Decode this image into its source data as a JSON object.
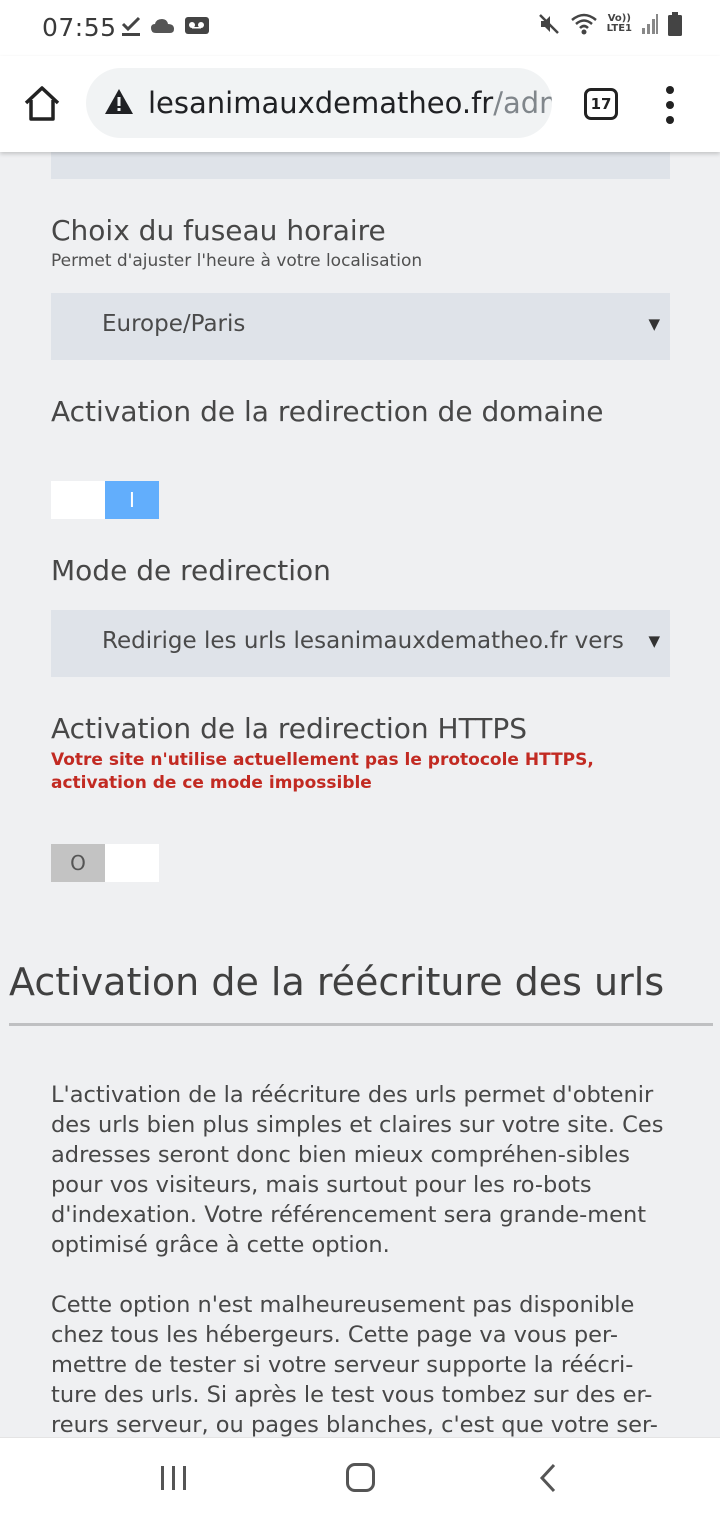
{
  "status": {
    "time": "07:55",
    "lte_top": "Vo))",
    "lte_bottom": "LTE1"
  },
  "browser": {
    "url_main": "lesanimauxdematheo.fr",
    "url_rest": "/adm",
    "tab_count": "17"
  },
  "form": {
    "timezone": {
      "title": "Choix du fuseau horaire",
      "help": "Permet d'ajuster l'heure à votre localisation",
      "value": "Europe/Paris"
    },
    "domain_redirect": {
      "title": "Activation de la redirection de domaine",
      "toggle_label": "I"
    },
    "redirect_mode": {
      "title": "Mode de redirection",
      "value": "Redirige les urls lesanimauxdematheo.fr vers"
    },
    "https_redirect": {
      "title": "Activation de la redirection HTTPS",
      "error": "Votre site n'utilise actuellement pas le protocole HTTPS, activation de ce mode impossible",
      "toggle_label": "O"
    }
  },
  "rewrite_section": {
    "title": "Activation de la réécriture des urls",
    "paragraph1": "L'activation de la réécriture des urls permet d'obtenir des urls bien plus simples et claires sur votre site. Ces adresses seront donc bien mieux compréhen-sibles pour vos visiteurs, mais surtout pour les ro-bots d'indexation. Votre référencement sera grande-ment optimisé grâce à cette option.",
    "paragraph2": "Cette option n'est malheureusement pas disponible chez tous les hébergeurs. Cette page va vous per-mettre de tester si votre serveur supporte la réécri-ture des urls. Si après le test vous tombez sur des er-reurs serveur, ou pages blanches, c'est que votre ser-"
  },
  "colors": {
    "accent_blue": "#62aefc",
    "error_red": "#c22a22",
    "field_bg": "#dfe3e9",
    "page_bg": "#eff0f2"
  }
}
